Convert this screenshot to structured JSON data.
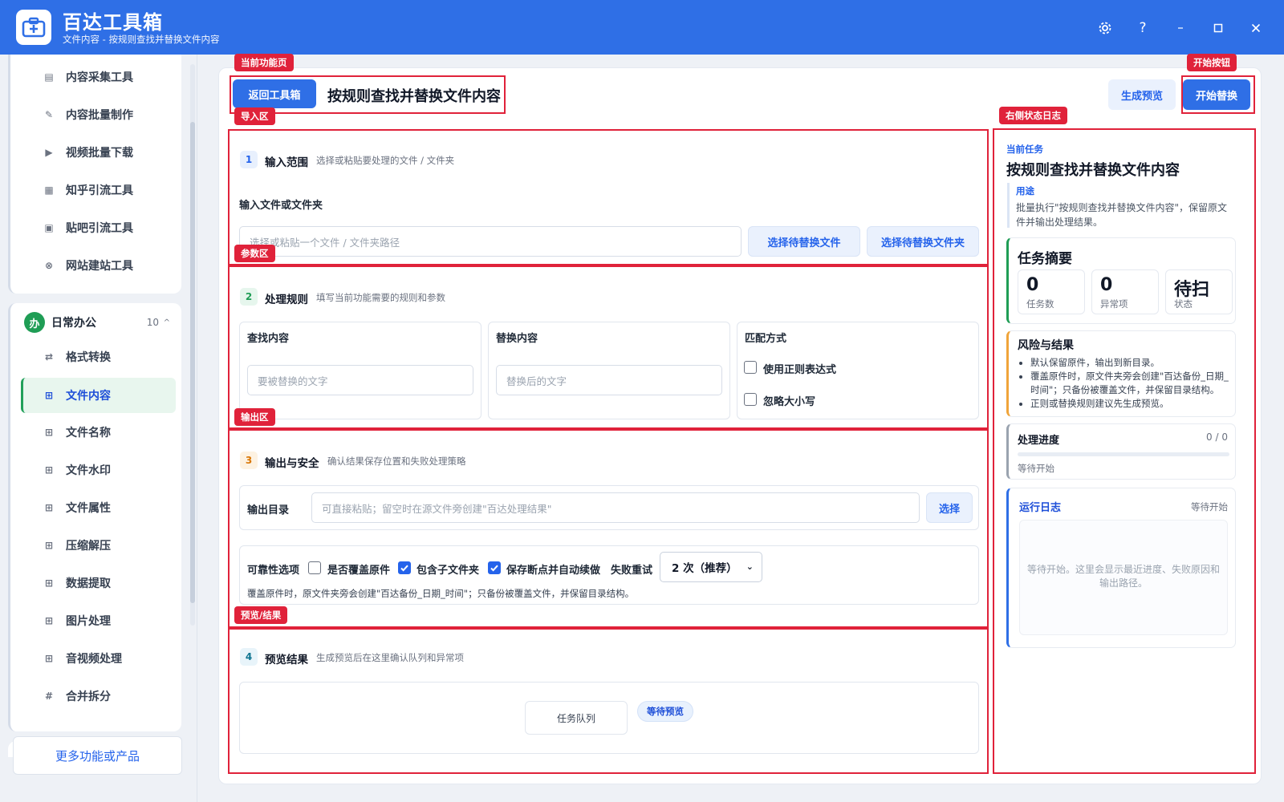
{
  "app": {
    "title": "百达工具箱",
    "subtitle": "文件内容 - 按规则查找并替换文件内容",
    "window_controls": [
      "gear-icon",
      "help-icon",
      "minimize-icon",
      "maximize-icon",
      "close-icon"
    ],
    "accent": "#2f6fe6"
  },
  "sidebar": {
    "group1_items": [
      {
        "label": "内容采集工具",
        "icon": "collect-icon"
      },
      {
        "label": "内容批量制作",
        "icon": "pen-icon"
      },
      {
        "label": "视频批量下载",
        "icon": "video-icon"
      },
      {
        "label": "知乎引流工具",
        "icon": "zhihu-icon"
      },
      {
        "label": "贴吧引流工具",
        "icon": "tieba-icon"
      },
      {
        "label": "网站建站工具",
        "icon": "site-icon"
      }
    ],
    "group2": {
      "badge": "办",
      "title": "日常办公",
      "count": "10",
      "caret": "^",
      "items": [
        {
          "label": "格式转换",
          "icon": "swap-icon"
        },
        {
          "label": "文件内容",
          "icon": "grid-icon",
          "active": true
        },
        {
          "label": "文件名称",
          "icon": "grid-icon"
        },
        {
          "label": "文件水印",
          "icon": "grid-icon"
        },
        {
          "label": "文件属性",
          "icon": "grid-icon"
        },
        {
          "label": "压缩解压",
          "icon": "grid-icon"
        },
        {
          "label": "数据提取",
          "icon": "grid-icon"
        },
        {
          "label": "图片处理",
          "icon": "grid-icon"
        },
        {
          "label": "音视频处理",
          "icon": "grid-icon"
        },
        {
          "label": "合并拆分",
          "icon": "hash-icon"
        }
      ]
    },
    "more_label": "更多功能或产品"
  },
  "annotations": {
    "current_page": "当前功能页",
    "start_button": "开始按钮",
    "import_area": "导入区",
    "status_log": "右侧状态日志",
    "param_area": "参数区",
    "output_area": "输出区",
    "preview_area": "预览/结果"
  },
  "header": {
    "back_label": "返回工具箱",
    "page_title": "按规则查找并替换文件内容",
    "preview_label": "生成预览",
    "start_label": "开始替换"
  },
  "section1": {
    "num": "1",
    "title": "输入范围",
    "desc": "选择或粘贴要处理的文件 / 文件夹",
    "field_label": "输入文件或文件夹",
    "placeholder": "选择或粘贴一个文件 / 文件夹路径",
    "btn_file": "选择待替换文件",
    "btn_folder": "选择待替换文件夹"
  },
  "section2": {
    "num": "2",
    "title": "处理规则",
    "desc": "填写当前功能需要的规则和参数",
    "find_label": "查找内容",
    "find_placeholder": "要被替换的文字",
    "replace_label": "替换内容",
    "replace_placeholder": "替换后的文字",
    "match_label": "匹配方式",
    "opt_regex": "使用正则表达式",
    "opt_ignore_case": "忽略大小写"
  },
  "section3": {
    "num": "3",
    "title": "输出与安全",
    "desc": "确认结果保存位置和失败处理策略",
    "outdir_label": "输出目录",
    "outdir_placeholder": "可直接粘贴；留空时在源文件旁创建\"百达处理结果\"",
    "outdir_btn": "选择",
    "reliability_label": "可靠性选项",
    "opt_overwrite": "是否覆盖原件",
    "opt_subfolders": "包含子文件夹",
    "opt_resume": "保存断点并自动续做",
    "retry_label": "失败重试",
    "retry_value": "2 次（推荐）",
    "note": "覆盖原件时，原文件夹旁会创建\"百达备份_日期_时间\"；只备份被覆盖文件，并保留目录结构。",
    "overwrite_checked": false,
    "subfolders_checked": true,
    "resume_checked": true
  },
  "section4": {
    "num": "4",
    "title": "预览结果",
    "desc": "生成预览后在这里确认队列和异常项",
    "queue_label": "任务队列",
    "queue_status": "等待预览"
  },
  "right": {
    "current_task_label": "当前任务",
    "current_task": "按规则查找并替换文件内容",
    "usage_label": "用途",
    "usage_text": "批量执行\"按规则查找并替换文件内容\"，保留原文件并输出处理结果。",
    "summary_title": "任务摘要",
    "stats": [
      {
        "value": "0",
        "label": "任务数"
      },
      {
        "value": "0",
        "label": "异常项"
      },
      {
        "value": "待扫",
        "label": "状态"
      }
    ],
    "risk_title": "风险与结果",
    "risk_items": [
      "默认保留原件，输出到新目录。",
      "覆盖原件时，原文件夹旁会创建\"百达备份_日期_时间\"；只备份被覆盖文件，并保留目录结构。",
      "正则或替换规则建议先生成预览。"
    ],
    "progress_title": "处理进度",
    "progress_count": "0 / 0",
    "progress_fraction": 0,
    "progress_status": "等待开始",
    "log_title": "运行日志",
    "log_status": "等待开始",
    "log_placeholder": "等待开始。这里会显示最近进度、失败原因和输出路径。"
  }
}
